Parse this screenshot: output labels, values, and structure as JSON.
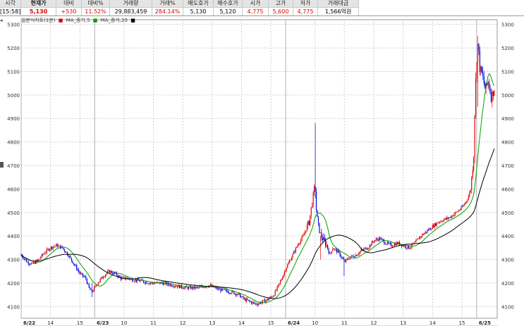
{
  "header": {
    "columns": [
      {
        "label": "시각",
        "value": "[15:58]",
        "w": 30
      },
      {
        "label": "현재가",
        "value": "5,130",
        "w": 50,
        "bold": true,
        "red": true
      },
      {
        "label": "대비",
        "value": "+530",
        "w": 36,
        "red": true
      },
      {
        "label": "대비%",
        "value": "11.52%",
        "w": 40,
        "red": true
      },
      {
        "label": "거래량",
        "value": "29,883,459",
        "w": 60
      },
      {
        "label": "거래%",
        "value": "284.14%",
        "w": 44,
        "red": true
      },
      {
        "label": "매도호가",
        "value": "5,130",
        "w": 43
      },
      {
        "label": "매수호가",
        "value": "5,120",
        "w": 41
      },
      {
        "label": "시가",
        "value": "4,775",
        "w": 37,
        "red": true
      },
      {
        "label": "고가",
        "value": "5,600",
        "w": 35,
        "red": true
      },
      {
        "label": "저가",
        "value": "4,775",
        "w": 35,
        "red": true
      },
      {
        "label": "거래대금",
        "value": "1,566억원",
        "w": 58
      }
    ]
  },
  "legend": {
    "title": "일분식차트(1분)",
    "ma5": "MA_종가,5",
    "ma20": "MA_종가,20"
  },
  "colors": {
    "up": "#e00000",
    "down": "#0000e0",
    "ma5": "#00a000",
    "ma20": "#000000",
    "grid": "#cfcfcf"
  },
  "chart_data": {
    "type": "candlestick",
    "title": "일분식차트(1분)",
    "y_range": [
      4050,
      5320
    ],
    "y_ticks": [
      4100,
      4200,
      4300,
      4400,
      4500,
      4600,
      4700,
      4800,
      4900,
      5000,
      5100,
      5200,
      5300
    ],
    "y_tick_labels": [
      "4100",
      "4200",
      "4300",
      "4400",
      "4500",
      "4600",
      "4700",
      "4800",
      "4900",
      "5000",
      "5100",
      "5200",
      "5300"
    ],
    "x_ticks": [
      {
        "label": "6/22",
        "x": 0,
        "bold": true
      },
      {
        "label": "14",
        "x": 10
      },
      {
        "label": "15",
        "x": 20
      },
      {
        "label": "6/23",
        "x": 25,
        "bold": true
      },
      {
        "label": "10",
        "x": 35
      },
      {
        "label": "11",
        "x": 45
      },
      {
        "label": "12",
        "x": 55
      },
      {
        "label": "13",
        "x": 65
      },
      {
        "label": "14",
        "x": 75
      },
      {
        "label": "15",
        "x": 85
      },
      {
        "label": "6/24",
        "x": 90,
        "bold": true
      },
      {
        "label": "10",
        "x": 100
      },
      {
        "label": "11",
        "x": 110
      },
      {
        "label": "12",
        "x": 120
      },
      {
        "label": "13",
        "x": 130
      },
      {
        "label": "14",
        "x": 140
      },
      {
        "label": "15",
        "x": 150
      },
      {
        "label": "6/25",
        "x": 155,
        "bold": true
      }
    ],
    "x_range": [
      0,
      162
    ],
    "price_path": [
      [
        0,
        4320
      ],
      [
        2,
        4290
      ],
      [
        4,
        4280
      ],
      [
        6,
        4300
      ],
      [
        8,
        4330
      ],
      [
        10,
        4350
      ],
      [
        12,
        4360
      ],
      [
        14,
        4350
      ],
      [
        16,
        4320
      ],
      [
        18,
        4280
      ],
      [
        20,
        4240
      ],
      [
        22,
        4220
      ],
      [
        23,
        4180
      ],
      [
        24,
        4160
      ],
      [
        26,
        4200
      ],
      [
        28,
        4230
      ],
      [
        30,
        4250
      ],
      [
        32,
        4240
      ],
      [
        34,
        4220
      ],
      [
        36,
        4220
      ],
      [
        40,
        4210
      ],
      [
        44,
        4200
      ],
      [
        48,
        4200
      ],
      [
        52,
        4190
      ],
      [
        56,
        4180
      ],
      [
        60,
        4180
      ],
      [
        64,
        4190
      ],
      [
        68,
        4170
      ],
      [
        72,
        4160
      ],
      [
        74,
        4150
      ],
      [
        76,
        4130
      ],
      [
        78,
        4120
      ],
      [
        80,
        4110
      ],
      [
        82,
        4120
      ],
      [
        84,
        4130
      ],
      [
        86,
        4150
      ],
      [
        88,
        4200
      ],
      [
        90,
        4260
      ],
      [
        92,
        4310
      ],
      [
        94,
        4360
      ],
      [
        96,
        4400
      ],
      [
        98,
        4460
      ],
      [
        99,
        4540
      ],
      [
        100,
        4620
      ],
      [
        100.5,
        4500
      ],
      [
        101,
        4450
      ],
      [
        102,
        4400
      ],
      [
        104,
        4360
      ],
      [
        105,
        4320
      ],
      [
        106,
        4350
      ],
      [
        108,
        4330
      ],
      [
        110,
        4290
      ],
      [
        112,
        4310
      ],
      [
        114,
        4320
      ],
      [
        116,
        4340
      ],
      [
        118,
        4350
      ],
      [
        120,
        4380
      ],
      [
        122,
        4390
      ],
      [
        124,
        4370
      ],
      [
        126,
        4360
      ],
      [
        128,
        4370
      ],
      [
        130,
        4360
      ],
      [
        132,
        4350
      ],
      [
        134,
        4370
      ],
      [
        136,
        4400
      ],
      [
        138,
        4420
      ],
      [
        140,
        4440
      ],
      [
        142,
        4460
      ],
      [
        144,
        4470
      ],
      [
        146,
        4480
      ],
      [
        148,
        4500
      ],
      [
        150,
        4520
      ],
      [
        152,
        4560
      ],
      [
        153,
        4600
      ],
      [
        154,
        4750
      ],
      [
        154.5,
        5000
      ],
      [
        155,
        5150
      ],
      [
        155.5,
        5230
      ],
      [
        156,
        5120
      ],
      [
        157,
        5080
      ],
      [
        158,
        5020
      ],
      [
        159,
        5060
      ],
      [
        160,
        4990
      ],
      [
        161,
        5030
      ]
    ],
    "events": [
      {
        "x": 100,
        "high": 4880,
        "low": 4560
      },
      {
        "x": 155.5,
        "high": 5250,
        "low": 4950
      },
      {
        "x": 110,
        "high": 4310,
        "low": 4230
      },
      {
        "x": 24,
        "high": 4200,
        "low": 4140
      },
      {
        "x": 102,
        "high": 4400,
        "low": 4300
      }
    ],
    "ma5_label": "MA_종가,5",
    "ma20_label": "MA_종가,20"
  }
}
